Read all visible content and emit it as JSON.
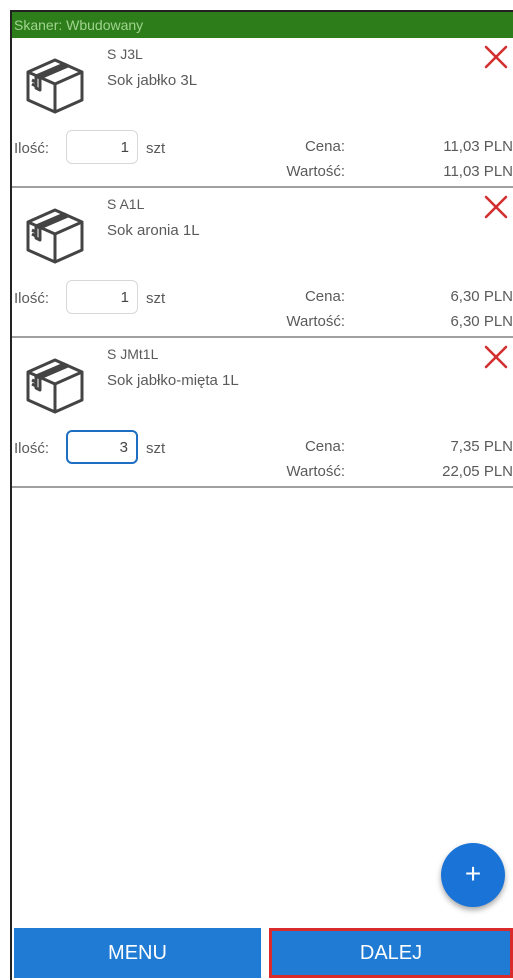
{
  "scanner_bar": {
    "text": "Skaner: Wbudowany"
  },
  "labels": {
    "qty": "Ilość:",
    "unit": "szt",
    "price": "Cena:",
    "value": "Wartość:"
  },
  "items": [
    {
      "code": "S J3L",
      "name": "Sok jabłko 3L",
      "qty": "1",
      "price": "11,03 PLN",
      "value": "11,03 PLN",
      "qty_focused": false
    },
    {
      "code": "S A1L",
      "name": "Sok aronia 1L",
      "qty": "1",
      "price": "6,30 PLN",
      "value": "6,30 PLN",
      "qty_focused": false
    },
    {
      "code": "S JMt1L",
      "name": "Sok jabłko-mięta 1L",
      "qty": "3",
      "price": "7,35 PLN",
      "value": "22,05 PLN",
      "qty_focused": true
    }
  ],
  "icons": {
    "product": "box-icon",
    "remove": "close-icon",
    "add": "plus-icon"
  },
  "colors": {
    "scanner_bar": "#2e7d1b",
    "primary": "#1f7bd3",
    "remove": "#d32f2f",
    "highlight_border": "#d92b2b"
  },
  "fab": {
    "symbol": "+"
  },
  "footer": {
    "menu_label": "MENU",
    "next_label": "DALEJ"
  }
}
